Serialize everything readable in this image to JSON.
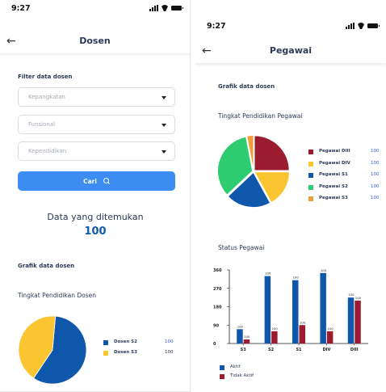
{
  "status_bar": {
    "time": "9:27"
  },
  "left_screen": {
    "title": "Dosen",
    "filter_heading": "Filter data dosen",
    "dropdowns": [
      {
        "placeholder": "Kepangkatan"
      },
      {
        "placeholder": "Funsional"
      },
      {
        "placeholder": "Kependidikan"
      }
    ],
    "search_button_label": "Cari",
    "result_label": "Data yang ditemukan",
    "result_value": "100",
    "chart_heading": "Grafik data dosen",
    "chart_subtitle": "Tingkat Pendidikan Dosen",
    "legend": [
      {
        "label": "Dosen S2",
        "value": "100",
        "color": "#0f57aa"
      },
      {
        "label": "Dosen S3",
        "value": "100",
        "color": "#fbc531"
      }
    ]
  },
  "right_screen": {
    "title": "Pegawai",
    "chart_heading": "Grafik data dosen",
    "pie_subtitle": "Tingkat Pendidikan Pegawai",
    "pie_legend": [
      {
        "label": "Pegawai DIII",
        "value": "100",
        "color": "#9b1c2e"
      },
      {
        "label": "Pegawai DIV",
        "value": "100",
        "color": "#fbc531"
      },
      {
        "label": "Pegawai S1",
        "value": "100",
        "color": "#0f57aa"
      },
      {
        "label": "Pegawai S2",
        "value": "100",
        "color": "#2ecc71"
      },
      {
        "label": "Pegawai S3",
        "value": "100",
        "color": "#f39c3c"
      }
    ],
    "bar_subtitle": "Status Pegawai",
    "bar_legend": [
      {
        "label": "Aktif",
        "color": "#0f57aa"
      },
      {
        "label": "Tidak Aktif",
        "color": "#9b1c2e"
      }
    ]
  },
  "chart_data": [
    {
      "type": "pie",
      "title": "Tingkat Pendidikan Dosen",
      "categories": [
        "Dosen S2",
        "Dosen S3"
      ],
      "values": [
        58,
        42
      ],
      "colors": [
        "#0f57aa",
        "#fbc531"
      ]
    },
    {
      "type": "pie",
      "title": "Tingkat Pendidikan Pegawai",
      "categories": [
        "Pegawai DIII",
        "Pegawai DIV",
        "Pegawai S1",
        "Pegawai S2",
        "Pegawai S3"
      ],
      "values": [
        25,
        17,
        21,
        34,
        3
      ],
      "colors": [
        "#9b1c2e",
        "#fbc531",
        "#0f57aa",
        "#2ecc71",
        "#f39c3c"
      ]
    },
    {
      "type": "bar",
      "title": "Status Pegawai",
      "categories": [
        "S3",
        "S2",
        "S1",
        "DIV",
        "DIII"
      ],
      "series": [
        {
          "name": "Aktif",
          "values": [
            70,
            330,
            310,
            345,
            225
          ],
          "labels": [
            "100",
            "100",
            "100",
            "100",
            "100"
          ],
          "color": "#0f57aa"
        },
        {
          "name": "Tidak Aktif",
          "values": [
            20,
            60,
            90,
            60,
            210
          ],
          "labels": [
            "100",
            "100",
            "100",
            "100",
            "100"
          ],
          "color": "#9b1c2e"
        }
      ],
      "yticks": [
        0,
        90,
        180,
        270,
        360
      ],
      "ylim": [
        0,
        360
      ]
    }
  ]
}
